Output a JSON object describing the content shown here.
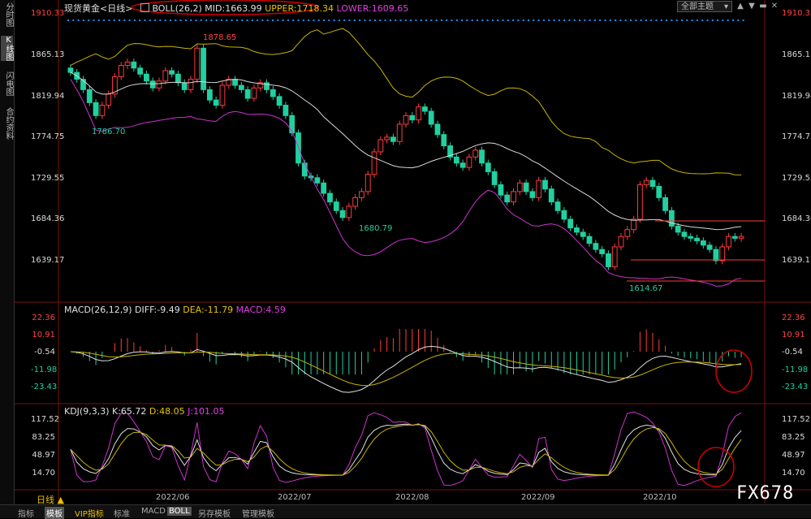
{
  "sidebar": {
    "items": [
      "分时图",
      "K线图",
      "闪电图",
      "合约资料"
    ]
  },
  "main_header": {
    "symbol": "现货黄金",
    "period_tag": "<日线>",
    "indicator": "BOLL(26,2)",
    "mid": "MID:1663.99",
    "upper": "UPPER:1718.34",
    "lower": "LOWER:1609.65"
  },
  "theme_button": {
    "label": "全部主题",
    "icon": "caret-down-icon"
  },
  "window_buttons": [
    "▲",
    "▼",
    "▬",
    "✕"
  ],
  "price_axis": {
    "labels": [
      "1910.33",
      "1865.13",
      "1819.94",
      "1774.75",
      "1729.55",
      "1684.36",
      "1639.17"
    ],
    "top_label_red": "1910.33"
  },
  "price_annotations": {
    "high": "1878.65",
    "low1": "1786.70",
    "low2": "1680.79",
    "low3": "1614.67"
  },
  "macd": {
    "title": "MACD(26,12,9)",
    "diff": "DIFF:-9.49",
    "dea": "DEA:-11.79",
    "macd": "MACD:4.59",
    "axis": [
      "22.36",
      "10.91",
      "-0.54",
      "-11.98",
      "-23.43"
    ]
  },
  "kdj": {
    "title": "KDJ(9,3,3)",
    "k": "K:65.72",
    "d": "D:48.05",
    "j": "J:101.05",
    "axis": [
      "117.52",
      "83.25",
      "48.97",
      "14.70"
    ]
  },
  "dates": [
    "2022/06",
    "2022/07",
    "2022/08",
    "2022/09",
    "2022/10"
  ],
  "period_button": "日线 ▲",
  "bottom_tabs": [
    "指标",
    "模板",
    "VIP指标",
    "标准",
    "MACD",
    "BOLL",
    "另存模板",
    "管理模板"
  ],
  "active_tabs": [
    "模板",
    "BOLL"
  ],
  "watermark": "FX678",
  "colors": {
    "up": "#ff3b3b",
    "down": "#21d0a0",
    "mid": "#d8d8d8",
    "upper": "#c8b400",
    "lower": "#cc33cc",
    "dot_marker": "#1e90ff"
  },
  "chart_data": {
    "type": "candlestick",
    "y_range": [
      1600,
      1915
    ],
    "candles_close": [
      1850,
      1842,
      1830,
      1815,
      1800,
      1812,
      1825,
      1845,
      1858,
      1862,
      1855,
      1848,
      1840,
      1832,
      1840,
      1852,
      1848,
      1838,
      1830,
      1842,
      1878,
      1830,
      1818,
      1812,
      1835,
      1842,
      1835,
      1830,
      1820,
      1832,
      1838,
      1830,
      1822,
      1812,
      1800,
      1780,
      1745,
      1730,
      1728,
      1722,
      1710,
      1700,
      1690,
      1682,
      1695,
      1705,
      1712,
      1732,
      1758,
      1772,
      1775,
      1770,
      1790,
      1800,
      1795,
      1810,
      1805,
      1790,
      1778,
      1765,
      1752,
      1745,
      1740,
      1752,
      1760,
      1745,
      1735,
      1720,
      1708,
      1700,
      1712,
      1722,
      1712,
      1705,
      1725,
      1715,
      1700,
      1690,
      1680,
      1670,
      1665,
      1660,
      1652,
      1645,
      1640,
      1625,
      1648,
      1660,
      1668,
      1680,
      1720,
      1725,
      1718,
      1705,
      1690,
      1672,
      1665,
      1660,
      1658,
      1655,
      1650,
      1645,
      1632,
      1648,
      1660,
      1658,
      1660
    ]
  }
}
